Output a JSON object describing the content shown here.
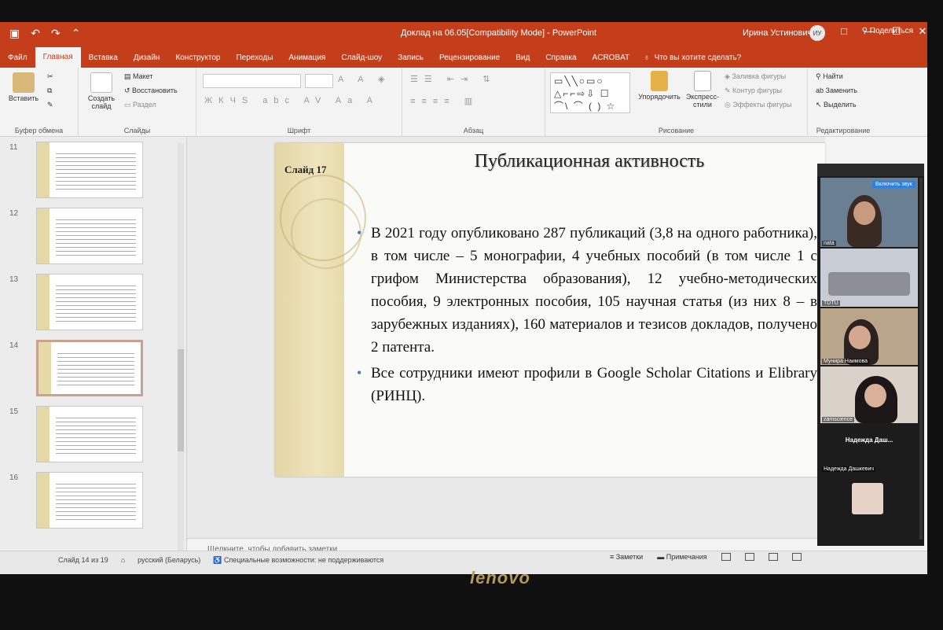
{
  "window": {
    "title": "Доклад на 06.05[Compatibility Mode] - PowerPoint",
    "user_name": "Ирина Устинович",
    "user_initials": "ИУ",
    "qat_icons": [
      "save-icon",
      "undo-icon",
      "redo-icon",
      "start-slideshow-icon"
    ],
    "controls": [
      "□",
      "—",
      "☐",
      "✕"
    ]
  },
  "ribbon_tabs": {
    "items": [
      "Файл",
      "Главная",
      "Вставка",
      "Дизайн",
      "Конструктор",
      "Переходы",
      "Анимация",
      "Слайд-шоу",
      "Запись",
      "Рецензирование",
      "Вид",
      "Справка",
      "ACROBAT"
    ],
    "active": "Главная",
    "tell_me": "Что вы хотите сделать?",
    "share": "Поделиться"
  },
  "ribbon": {
    "clipboard": {
      "paste": "Вставить",
      "label": "Буфер обмена"
    },
    "slides": {
      "new_slide": "Создать слайд",
      "layout": "Макет",
      "reset": "Восстановить",
      "section": "Раздел",
      "label": "Слайды"
    },
    "font": {
      "label": "Шрифт"
    },
    "paragraph": {
      "label": "Абзац"
    },
    "drawing": {
      "shapes": "△⌐⌐⇨⇩ ☐ ⌒\\ ⌒ ( ) ☆",
      "arrange": "Упорядочить",
      "quick_styles": "Экспресс-стили",
      "fill": "Заливка фигуры",
      "outline": "Контур фигуры",
      "effects": "Эффекты фигуры",
      "label": "Рисование"
    },
    "editing": {
      "find": "Найти",
      "replace": "Заменить",
      "select": "Выделить",
      "label": "Редактирование"
    }
  },
  "thumbnails": [
    {
      "num": "11",
      "selected": false
    },
    {
      "num": "12",
      "selected": false
    },
    {
      "num": "13",
      "selected": false
    },
    {
      "num": "14",
      "selected": true
    },
    {
      "num": "15",
      "selected": false
    },
    {
      "num": "16",
      "selected": false
    }
  ],
  "slide": {
    "label": "Слайд 17",
    "title": "Публикационная активность",
    "bullets": [
      "В 2021 году опубликовано 287 публикаций (3,8 на одного работника), в том числе – 5 монографии, 4 учебных пособий (в том числе 1 с грифом Министерства образования), 12 учебно-методических пособия, 9 электронных пособия, 105 научная статья (из них 8 – в зарубежных изданиях), 160 материалов и тезисов докладов, получено 2 патента.",
      "Все сотрудники имеют профили в Google Scholar Citations и Elibrary (РИНЦ)."
    ]
  },
  "notes_placeholder": "Щелкните, чтобы добавить заметки",
  "status": {
    "slide_count": "Слайд 14 из 19",
    "language": "русский (Беларусь)",
    "accessibility": "Специальные возможности: не поддерживаются",
    "notes_button": "Заметки",
    "comments_button": "Примечания"
  },
  "video_call": {
    "unmute": "Включить звук",
    "participants": [
      {
        "name": "nata"
      },
      {
        "name": "TDTU"
      },
      {
        "name": "Мунира Наимова"
      },
      {
        "name": "zamscience"
      },
      {
        "name": "Надежда Даш..."
      },
      {
        "name": "Надежда Дашкевич"
      }
    ]
  },
  "brand": "lenovo",
  "colors": {
    "accent": "#c43e1c",
    "slide_band": "#e3d6a4"
  }
}
